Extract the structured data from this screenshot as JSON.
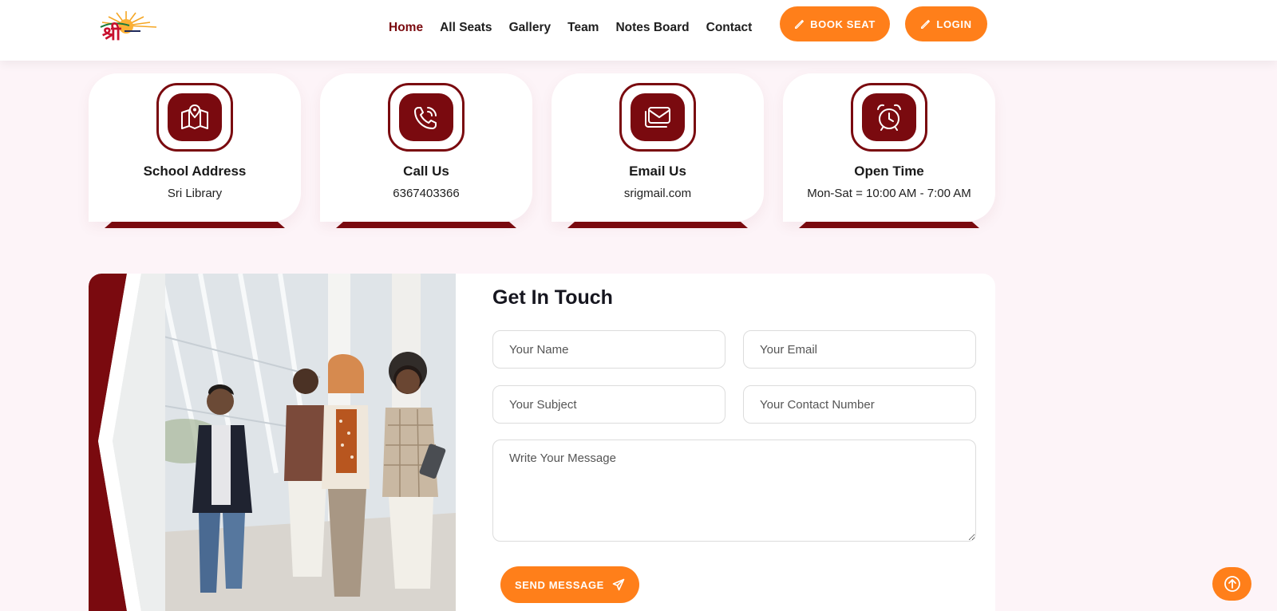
{
  "header": {
    "nav": [
      {
        "label": "Home",
        "active": true
      },
      {
        "label": "All Seats"
      },
      {
        "label": "Gallery"
      },
      {
        "label": "Team"
      },
      {
        "label": "Notes Board"
      },
      {
        "label": "Contact"
      }
    ],
    "book_seat_label": "BOOK SEAT",
    "login_label": "LOGIN"
  },
  "info_cards": [
    {
      "icon": "map-location-icon",
      "title": "School Address",
      "text": "Sri Library"
    },
    {
      "icon": "phone-icon",
      "title": "Call Us",
      "text": "6367403366"
    },
    {
      "icon": "email-icon",
      "title": "Email Us",
      "text": "srigmail.com"
    },
    {
      "icon": "alarm-clock-icon",
      "title": "Open Time",
      "text": "Mon-Sat = 10:00 AM - 7:00 AM"
    }
  ],
  "contact_form": {
    "title": "Get In Touch",
    "name_placeholder": "Your Name",
    "email_placeholder": "Your Email",
    "subject_placeholder": "Your Subject",
    "contact_number_placeholder": "Your Contact Number",
    "message_placeholder": "Write Your Message",
    "send_label": "SEND MESSAGE"
  },
  "colors": {
    "brand_maroon": "#7a0a0f",
    "accent_orange": "#ff7f1a",
    "page_background": "#fdf4f8"
  }
}
